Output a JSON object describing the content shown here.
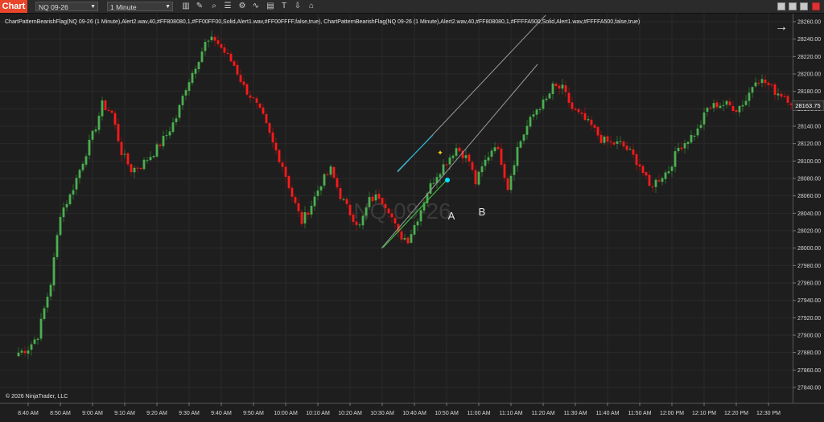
{
  "toolbar": {
    "chart_tab": "Chart",
    "instrument": "NQ 09-26",
    "interval": "1 Minute",
    "icons": [
      "bars-icon",
      "pencil-icon",
      "zoom-icon",
      "properties-icon",
      "strategy-icon",
      "indicator-icon",
      "template-icon",
      "text-icon",
      "down-icon",
      "lock-icon",
      "copy-icon"
    ]
  },
  "indicator_label": "ChartPatternBearishFlag(NQ 09-26 (1 Minute),Alert2.wav,40,#FF808080,1,#FF00FF00,Solid,Alert1.wav,#FF00FFFF,false,true), ChartPatternBearishFlag(NQ 09-26 (1 Minute),Alert2.wav,40,#FF808080,1,#FFFFA500,Solid,Alert1.wav,#FFFFA500,false,true)",
  "copyright": "© 2026 NinjaTrader, LLC",
  "watermark": "NQ 09-26",
  "annotations": {
    "a": "A",
    "b": "B"
  },
  "last_price_label": "28163.75",
  "colors": {
    "up": "#4caf50",
    "down": "#ff1a1a",
    "wick_up": "#2e7d32",
    "channel": "#9a9a9a",
    "flag_green": "#3db83d",
    "flag_cyan": "#22b8d8",
    "marker_cyan": "#00e5ff",
    "marker_yellow": "#ffd21a",
    "last_price_bg": "#2a2a2a"
  },
  "chart_data": {
    "type": "candlestick",
    "title": "",
    "ylim": [
      27830,
      28260
    ],
    "y_ticks": [
      28260,
      28240,
      28220,
      28200,
      28180,
      28160,
      28140,
      28120,
      28100,
      28080,
      28060,
      28040,
      28020,
      28000,
      27980,
      27960,
      27940,
      27920,
      27900,
      27880,
      27860,
      27840
    ],
    "y_tick_labels": [
      "28260.00",
      "28240.00",
      "28220.00",
      "28200.00",
      "28180.00",
      "28160.00",
      "28140.00",
      "28120.00",
      "28100.00",
      "28080.00",
      "28060.00",
      "28040.00",
      "28020.00",
      "28000.00",
      "27980.00",
      "27960.00",
      "27940.00",
      "27920.00",
      "27900.00",
      "27880.00",
      "27860.00",
      "27840.00"
    ],
    "x_tick_labels": [
      "8:40 AM",
      "8:50 AM",
      "9:00 AM",
      "9:10 AM",
      "9:20 AM",
      "9:30 AM",
      "9:40 AM",
      "9:50 AM",
      "10:00 AM",
      "10:10 AM",
      "10:20 AM",
      "10:30 AM",
      "10:40 AM",
      "10:50 AM",
      "11:00 AM",
      "11:10 AM",
      "11:20 AM",
      "11:30 AM",
      "11:40 AM",
      "11:50 AM",
      "12:00 PM",
      "12:10 PM",
      "12:20 PM",
      "12:30 PM"
    ],
    "start_time": "8:37 AM",
    "interval_minutes": 1,
    "close_path": [
      [
        0,
        27880
      ],
      [
        3,
        27885
      ],
      [
        6,
        27900
      ],
      [
        10,
        27960
      ],
      [
        13,
        28040
      ],
      [
        16,
        28060
      ],
      [
        20,
        28100
      ],
      [
        24,
        28140
      ],
      [
        26,
        28165
      ],
      [
        29,
        28155
      ],
      [
        32,
        28110
      ],
      [
        35,
        28090
      ],
      [
        38,
        28095
      ],
      [
        42,
        28110
      ],
      [
        46,
        28130
      ],
      [
        49,
        28150
      ],
      [
        52,
        28185
      ],
      [
        55,
        28210
      ],
      [
        58,
        28235
      ],
      [
        61,
        28240
      ],
      [
        64,
        28225
      ],
      [
        67,
        28210
      ],
      [
        70,
        28185
      ],
      [
        73,
        28170
      ],
      [
        76,
        28150
      ],
      [
        79,
        28120
      ],
      [
        82,
        28095
      ],
      [
        85,
        28060
      ],
      [
        88,
        28030
      ],
      [
        91,
        28050
      ],
      [
        94,
        28075
      ],
      [
        97,
        28090
      ],
      [
        100,
        28060
      ],
      [
        103,
        28040
      ],
      [
        106,
        28025
      ],
      [
        109,
        28055
      ],
      [
        112,
        28060
      ],
      [
        115,
        28045
      ],
      [
        118,
        28015
      ],
      [
        121,
        28010
      ],
      [
        124,
        28035
      ],
      [
        127,
        28065
      ],
      [
        130,
        28085
      ],
      [
        133,
        28100
      ],
      [
        136,
        28115
      ],
      [
        137,
        28112
      ],
      [
        140,
        28100
      ],
      [
        142,
        28075
      ],
      [
        145,
        28100
      ],
      [
        148,
        28120
      ],
      [
        150,
        28100
      ],
      [
        152,
        28070
      ],
      [
        155,
        28115
      ],
      [
        158,
        28140
      ],
      [
        161,
        28160
      ],
      [
        164,
        28170
      ],
      [
        166,
        28185
      ],
      [
        169,
        28183
      ],
      [
        172,
        28160
      ],
      [
        175,
        28150
      ],
      [
        178,
        28140
      ],
      [
        181,
        28125
      ],
      [
        184,
        28120
      ],
      [
        187,
        28120
      ],
      [
        190,
        28110
      ],
      [
        193,
        28095
      ],
      [
        196,
        28070
      ],
      [
        199,
        28080
      ],
      [
        202,
        28090
      ],
      [
        205,
        28115
      ],
      [
        208,
        28125
      ],
      [
        211,
        28135
      ],
      [
        214,
        28160
      ],
      [
        217,
        28165
      ],
      [
        220,
        28165
      ],
      [
        223,
        28160
      ],
      [
        226,
        28170
      ],
      [
        229,
        28195
      ],
      [
        232,
        28190
      ],
      [
        235,
        28180
      ],
      [
        238,
        28175
      ],
      [
        241,
        28165
      ]
    ],
    "last_close": 28163.75
  }
}
